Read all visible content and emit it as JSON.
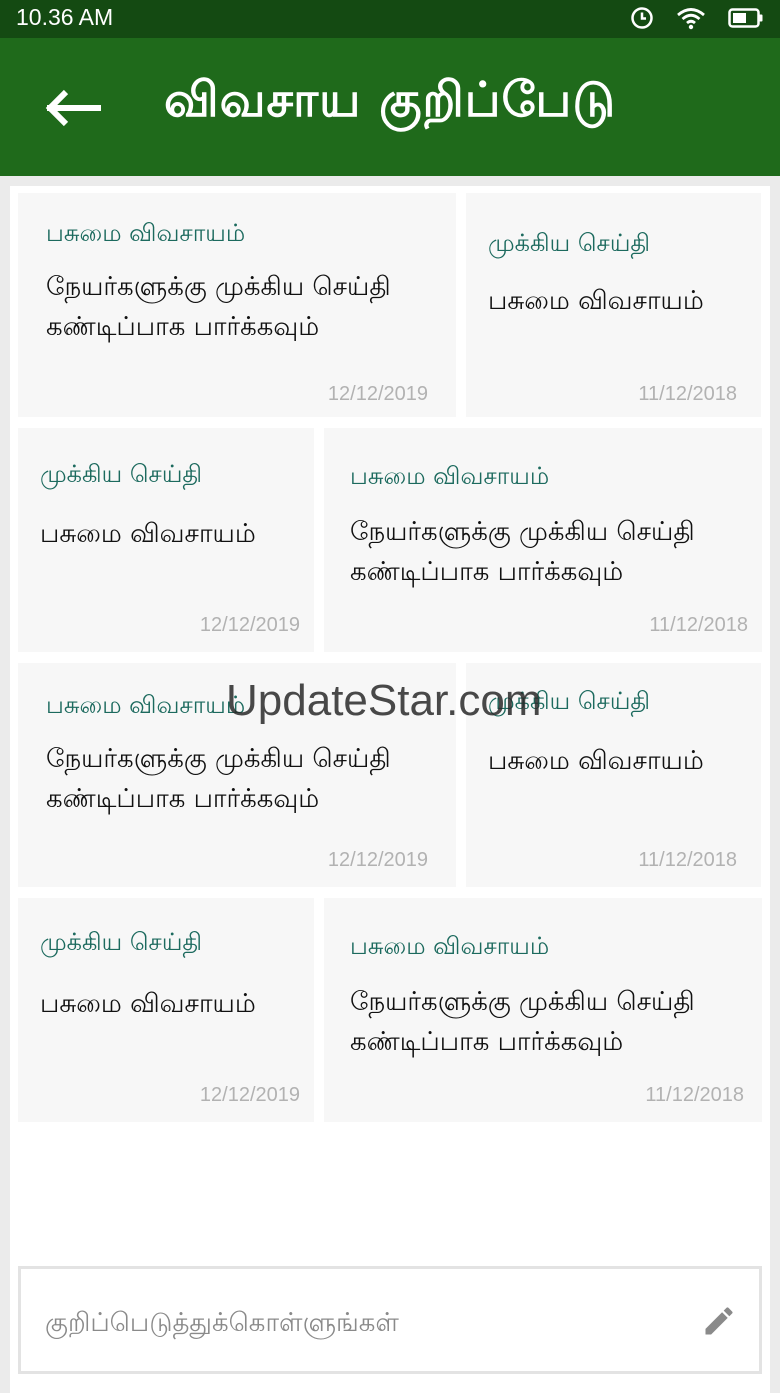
{
  "status_bar": {
    "time": "10.36 AM",
    "icons": [
      "clock-icon",
      "wifi-icon",
      "battery-icon"
    ]
  },
  "header": {
    "title": "விவசாய குறிப்பேடு",
    "back_icon": "back-arrow-icon"
  },
  "colors": {
    "header": "#1f6a1b",
    "status_bar": "#144a12",
    "category": "#1c6a5e",
    "date": "#b2b2b2"
  },
  "notes": [
    {
      "category": "பசுமை விவசாயம்",
      "text": "நேயர்களுக்கு முக்கிய செய்தி கண்டிப்பாக பார்க்கவும்",
      "date": "12/12/2019"
    },
    {
      "category": "முக்கிய செய்தி",
      "text": "பசுமை விவசாயம்",
      "date": "11/12/2018"
    },
    {
      "category": "முக்கிய செய்தி",
      "text": "பசுமை விவசாயம்",
      "date": "12/12/2019"
    },
    {
      "category": "பசுமை விவசாயம்",
      "text": "நேயர்களுக்கு முக்கிய செய்தி கண்டிப்பாக பார்க்கவும்",
      "date": "11/12/2018"
    },
    {
      "category": "பசுமை விவசாயம்",
      "text": "நேயர்களுக்கு முக்கிய செய்தி கண்டிப்பாக பார்க்கவும்",
      "date": "12/12/2019"
    },
    {
      "category": "முக்கிய செய்தி",
      "text": "பசுமை விவசாயம்",
      "date": "11/12/2018"
    },
    {
      "category": "முக்கிய செய்தி",
      "text": "பசுமை விவசாயம்",
      "date": "12/12/2019"
    },
    {
      "category": "பசுமை விவசாயம்",
      "text": "நேயர்களுக்கு முக்கிய செய்தி கண்டிப்பாக பார்க்கவும்",
      "date": "11/12/2018"
    }
  ],
  "watermark": "UpdateStar.com",
  "note_input": {
    "placeholder": "குறிப்பெடுத்துக்கொள்ளுங்கள்",
    "value": "",
    "icon": "pencil-icon"
  }
}
